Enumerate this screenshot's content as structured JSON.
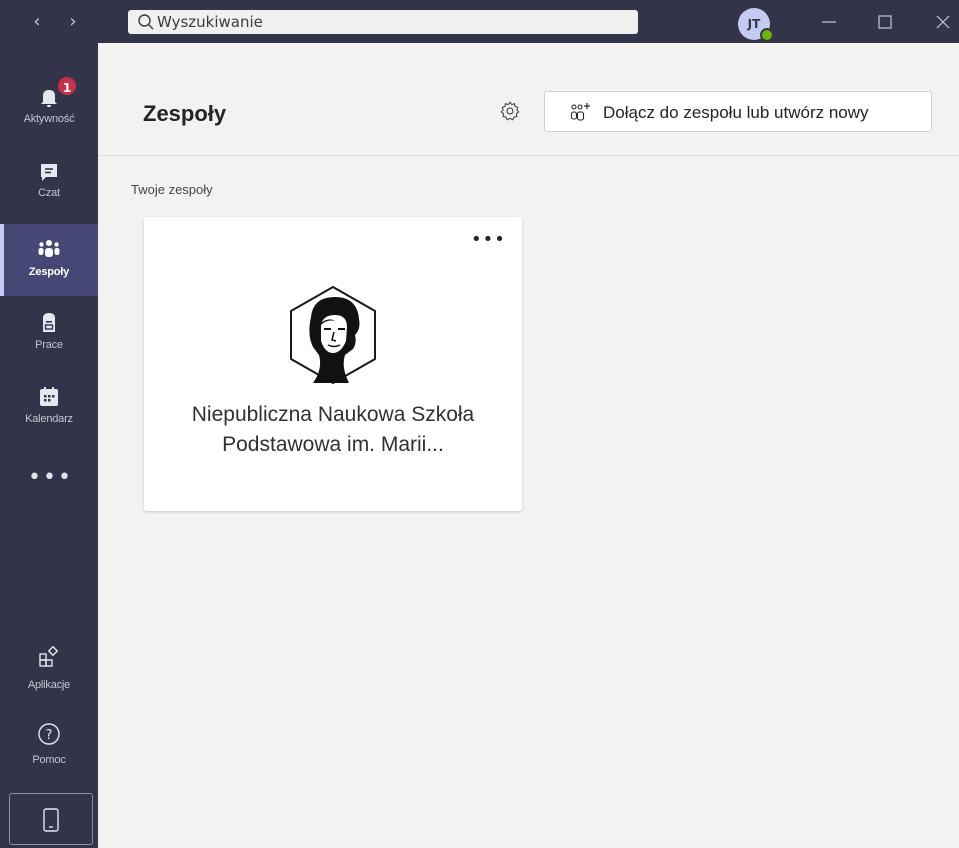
{
  "titlebar": {
    "search_placeholder": "Wyszukiwanie",
    "avatar_initials": "JT",
    "status_color": "#6bb700"
  },
  "rail": {
    "items": [
      {
        "label": "Aktywność",
        "icon": "bell-icon",
        "badge": "1"
      },
      {
        "label": "Czat",
        "icon": "chat-icon"
      },
      {
        "label": "Zespoły",
        "icon": "teams-icon",
        "active": true
      },
      {
        "label": "Prace",
        "icon": "assignments-icon"
      },
      {
        "label": "Kalendarz",
        "icon": "calendar-icon"
      }
    ],
    "more": "•••",
    "bottom_items": [
      {
        "label": "Aplikacje",
        "icon": "apps-icon"
      },
      {
        "label": "Pomoc",
        "icon": "help-icon"
      }
    ]
  },
  "header": {
    "title": "Zespoły",
    "join_button_label": "Dołącz do zespołu lub utwórz nowy"
  },
  "main": {
    "section_label": "Twoje zespoły",
    "teams": [
      {
        "name": "Niepubliczna Naukowa Szkoła Podstawowa im. Marii...",
        "more": "•••"
      }
    ]
  },
  "colors": {
    "rail_bg": "#33344a",
    "active_item_bg": "#464775",
    "badge": "#c4314b",
    "content_bg": "#f3f2f1"
  }
}
